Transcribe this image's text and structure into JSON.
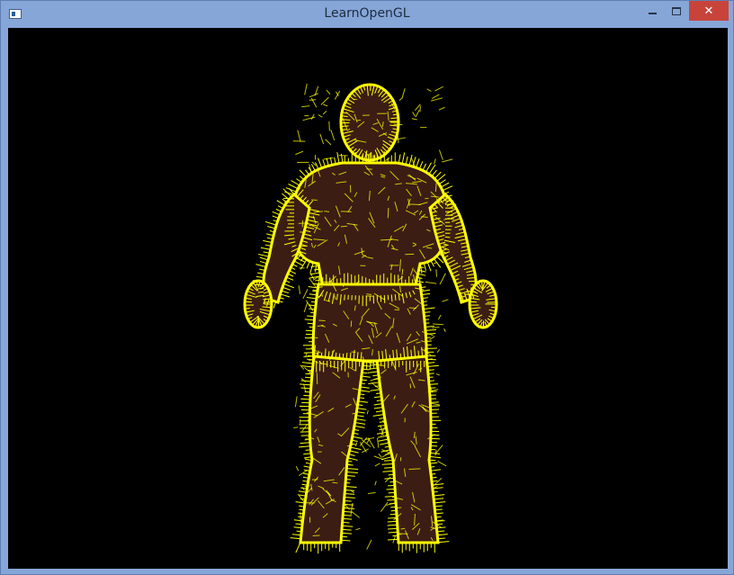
{
  "window": {
    "title": "LearnOpenGL",
    "icon": "opengl-app-icon",
    "controls": {
      "minimize": "minimize-icon",
      "maximize": "maximize-icon",
      "close": "close-icon"
    }
  },
  "render": {
    "background_color": "#000000",
    "normal_lines_color": "#ffff00",
    "model_color": "#3a1a12"
  }
}
